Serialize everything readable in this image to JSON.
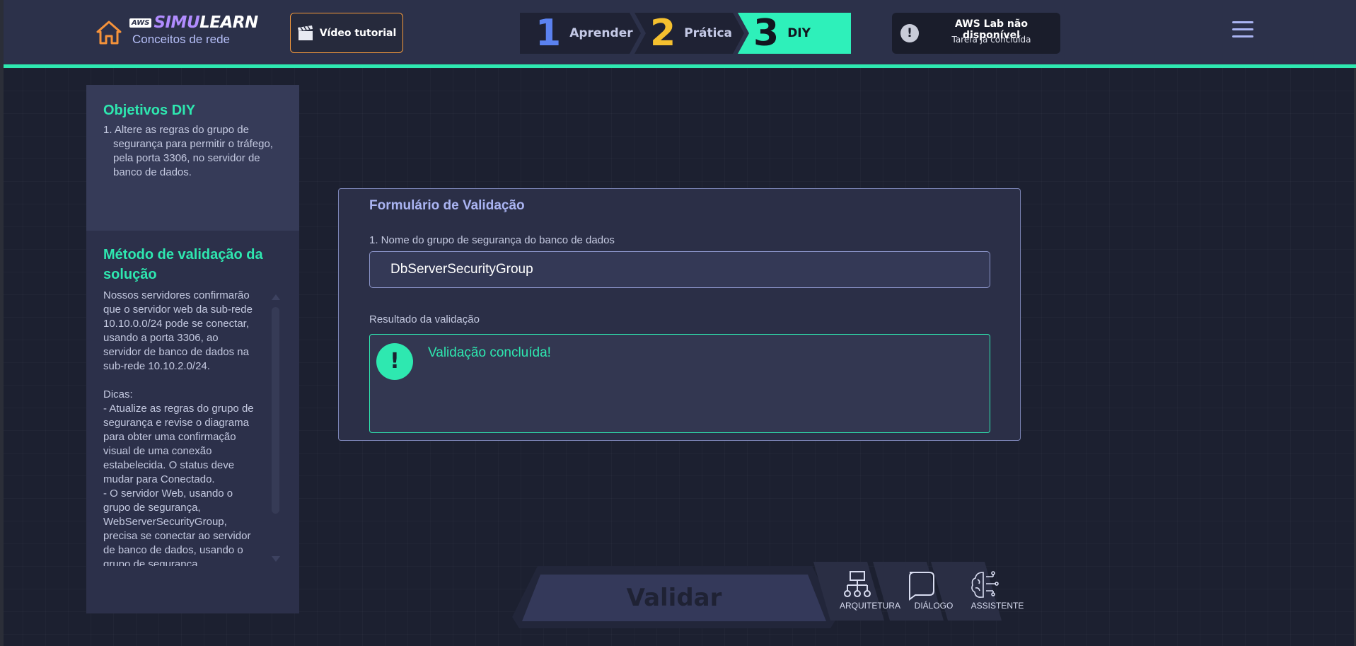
{
  "header": {
    "logo_aws": "AWS",
    "logo_brand_a": "SIMU",
    "logo_brand_b": "LEARN",
    "logo_sub": "Conceitos de rede",
    "video_button": "Vídeo tutorial",
    "steps": [
      {
        "num": "1",
        "label": "Aprender"
      },
      {
        "num": "2",
        "label": "Prática"
      },
      {
        "num": "3",
        "label": "DIY"
      }
    ],
    "lab_title": "AWS Lab não disponível",
    "lab_subtitle": "Tarefa já concluída",
    "lab_icon": "!"
  },
  "objectives": {
    "title": "Objetivos DIY",
    "items": [
      "1. Altere as regras do grupo de segurança para permitir o tráfego, pela porta 3306, no servidor de banco de dados."
    ]
  },
  "method": {
    "title": "Método de validação da solução",
    "text": "Nossos servidores confirmarão que o servidor web da sub-rede 10.10.0.0/24 pode se conectar, usando a porta 3306, ao servidor de banco de dados na sub-rede 10.10.2.0/24.\n\nDicas:\n- Atualize as regras do grupo de segurança e revise o diagrama para obter uma confirmação visual de uma conexão estabelecida. O status deve mudar para Conectado.\n- O servidor Web, usando o grupo de segurança, WebServerSecurityGroup, precisa se conectar ao servidor de banco de dados, usando o grupo de segurança,"
  },
  "form": {
    "title": "Formulário de Validação",
    "question_label": "1. Nome do grupo de segurança do banco de dados",
    "question_value": "DbServerSecurityGroup",
    "result_label": "Resultado da validação",
    "result_icon": "!",
    "result_text": "Validação concluída!"
  },
  "bottom": {
    "validate_label": "Validar",
    "tools": [
      {
        "label": "ARQUITETURA",
        "icon": "network-icon"
      },
      {
        "label": "DIÁLOGO",
        "icon": "speech-bubble-icon"
      },
      {
        "label": "ASSISTENTE",
        "icon": "brain-circuit-icon"
      }
    ]
  },
  "colors": {
    "accent": "#2ee8b0",
    "step1": "#5b82f0",
    "step2": "#f5c02f",
    "brand_purple": "#b18cff",
    "video_border": "#f59a3d",
    "home_orange": "#f5923a"
  }
}
